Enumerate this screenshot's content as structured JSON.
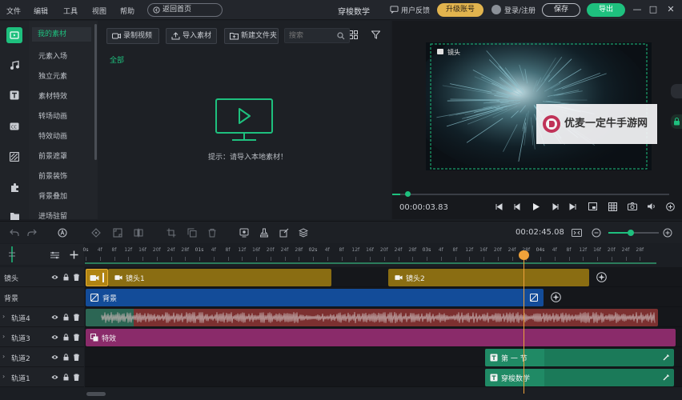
{
  "colors": {
    "accent": "#1ec07e",
    "upgrade": "#e2b44e",
    "playhead": "#f0a23a"
  },
  "titlebar": {
    "menus": [
      "文件",
      "编辑",
      "工具",
      "视图",
      "帮助"
    ],
    "back_home": "返回首页",
    "app_title": "穿梭数学",
    "feedback": "用户反馈",
    "upgrade": "升级账号",
    "login": "登录/注册",
    "save": "保存",
    "export": "导出",
    "window_controls": [
      "—",
      "□",
      "✕"
    ]
  },
  "rail": {
    "icons": [
      "media-icon",
      "music-icon",
      "text-icon",
      "subtitle-icon",
      "filter-icon",
      "plugin-icon",
      "folder-icon"
    ]
  },
  "categories": [
    "我的素材",
    "元素入场",
    "独立元素",
    "素材特效",
    "转场动画",
    "特效动画",
    "前景遮罩",
    "前景装饰",
    "背景叠加",
    "进场驻留"
  ],
  "material": {
    "record_video": "录制视频",
    "import_material": "导入素材",
    "new_folder": "新建文件夹",
    "search_placeholder": "搜索",
    "filter_all": "全部",
    "empty_hint": "提示：请导入本地素材！"
  },
  "preview": {
    "frame_label": "镜头",
    "time": "00:00:03.83",
    "progress_fraction": 0.03
  },
  "watermark": {
    "text": "优麦一定牛手游网"
  },
  "edit_toolbar": {
    "timecode": "00:02:45.08",
    "zoom_fraction": 0.45
  },
  "timeline": {
    "ruler_labels": [
      "0s",
      "4f",
      "8f",
      "12f",
      "16f",
      "20f",
      "24f",
      "28f",
      "01s",
      "4f",
      "8f",
      "12f",
      "16f",
      "20f",
      "24f",
      "28f",
      "02s",
      "4f",
      "8f",
      "12f",
      "16f",
      "20f",
      "24f",
      "28f",
      "03s",
      "4f",
      "8f",
      "12f",
      "16f",
      "20f",
      "24f",
      "28f",
      "04s",
      "4f",
      "8f",
      "12f",
      "16f",
      "20f",
      "24f",
      "28f"
    ],
    "tracks": [
      {
        "name": "镜头",
        "clips": [
          "镜头1",
          "镜头2"
        ]
      },
      {
        "name": "背景",
        "clips": [
          "背景"
        ]
      },
      {
        "name": "轨道4",
        "clips": []
      },
      {
        "name": "轨道3",
        "clips": [
          "特效"
        ]
      },
      {
        "name": "轨道2",
        "clips": [
          "第 一 节"
        ]
      },
      {
        "name": "轨道1",
        "clips": [
          "穿梭数学"
        ]
      }
    ]
  }
}
